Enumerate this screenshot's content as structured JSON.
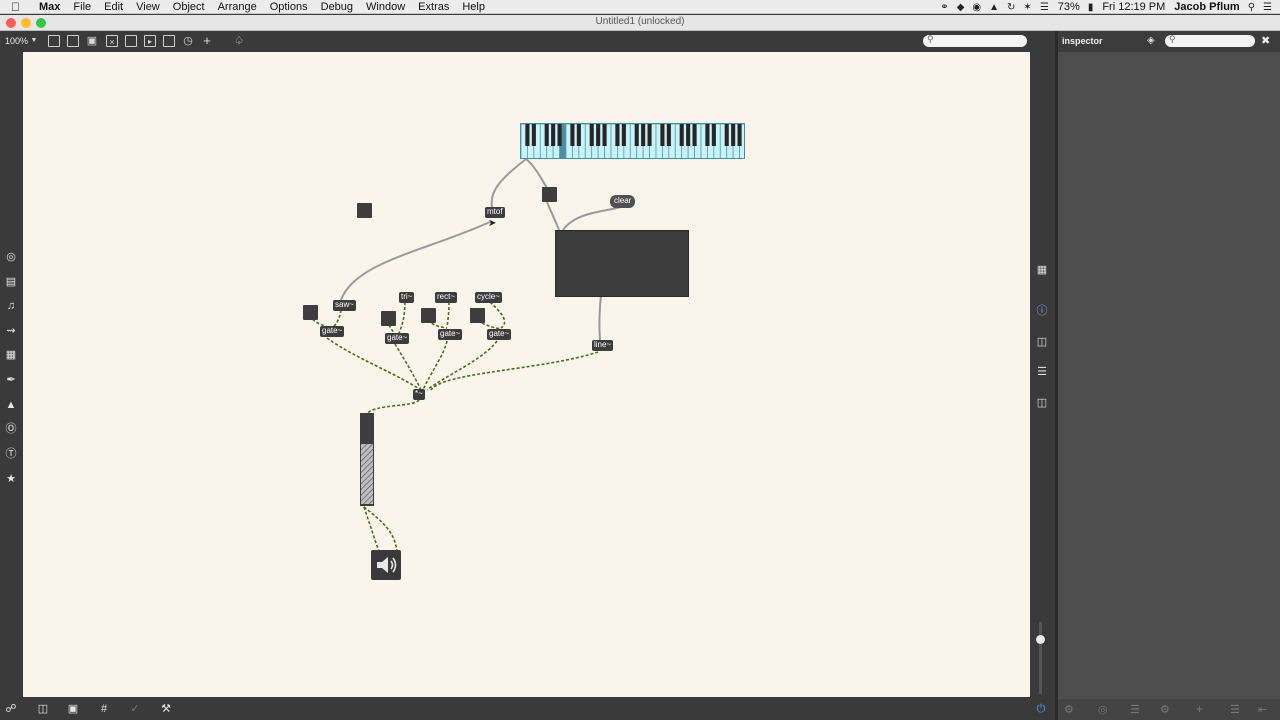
{
  "menubar": {
    "app": "Max",
    "items": [
      "File",
      "Edit",
      "View",
      "Object",
      "Arrange",
      "Options",
      "Debug",
      "Window",
      "Extras",
      "Help"
    ],
    "battery": "73%",
    "clock": "Fri 12:19 PM",
    "user": "Jacob Pflum"
  },
  "window": {
    "title": "Untitled1 (unlocked)"
  },
  "toolbar": {
    "zoom": "100%"
  },
  "inspector": {
    "title": "inspector"
  },
  "patch": {
    "objects": {
      "mtof": "mtof",
      "saw": "saw~",
      "tri": "tri~",
      "rect": "rect~",
      "cycle": "cycle~",
      "gate1": "gate~",
      "gate2": "gate~",
      "gate3": "gate~",
      "gate4": "gate~",
      "mult": "*~",
      "line": "line~"
    },
    "clear_message": "clear"
  },
  "colors": {
    "canvas": "#faf5ea",
    "object_box": "#3c3c3c",
    "signal_cord": "#4a6e1f",
    "keyboard_white": "#c8f4fb"
  }
}
